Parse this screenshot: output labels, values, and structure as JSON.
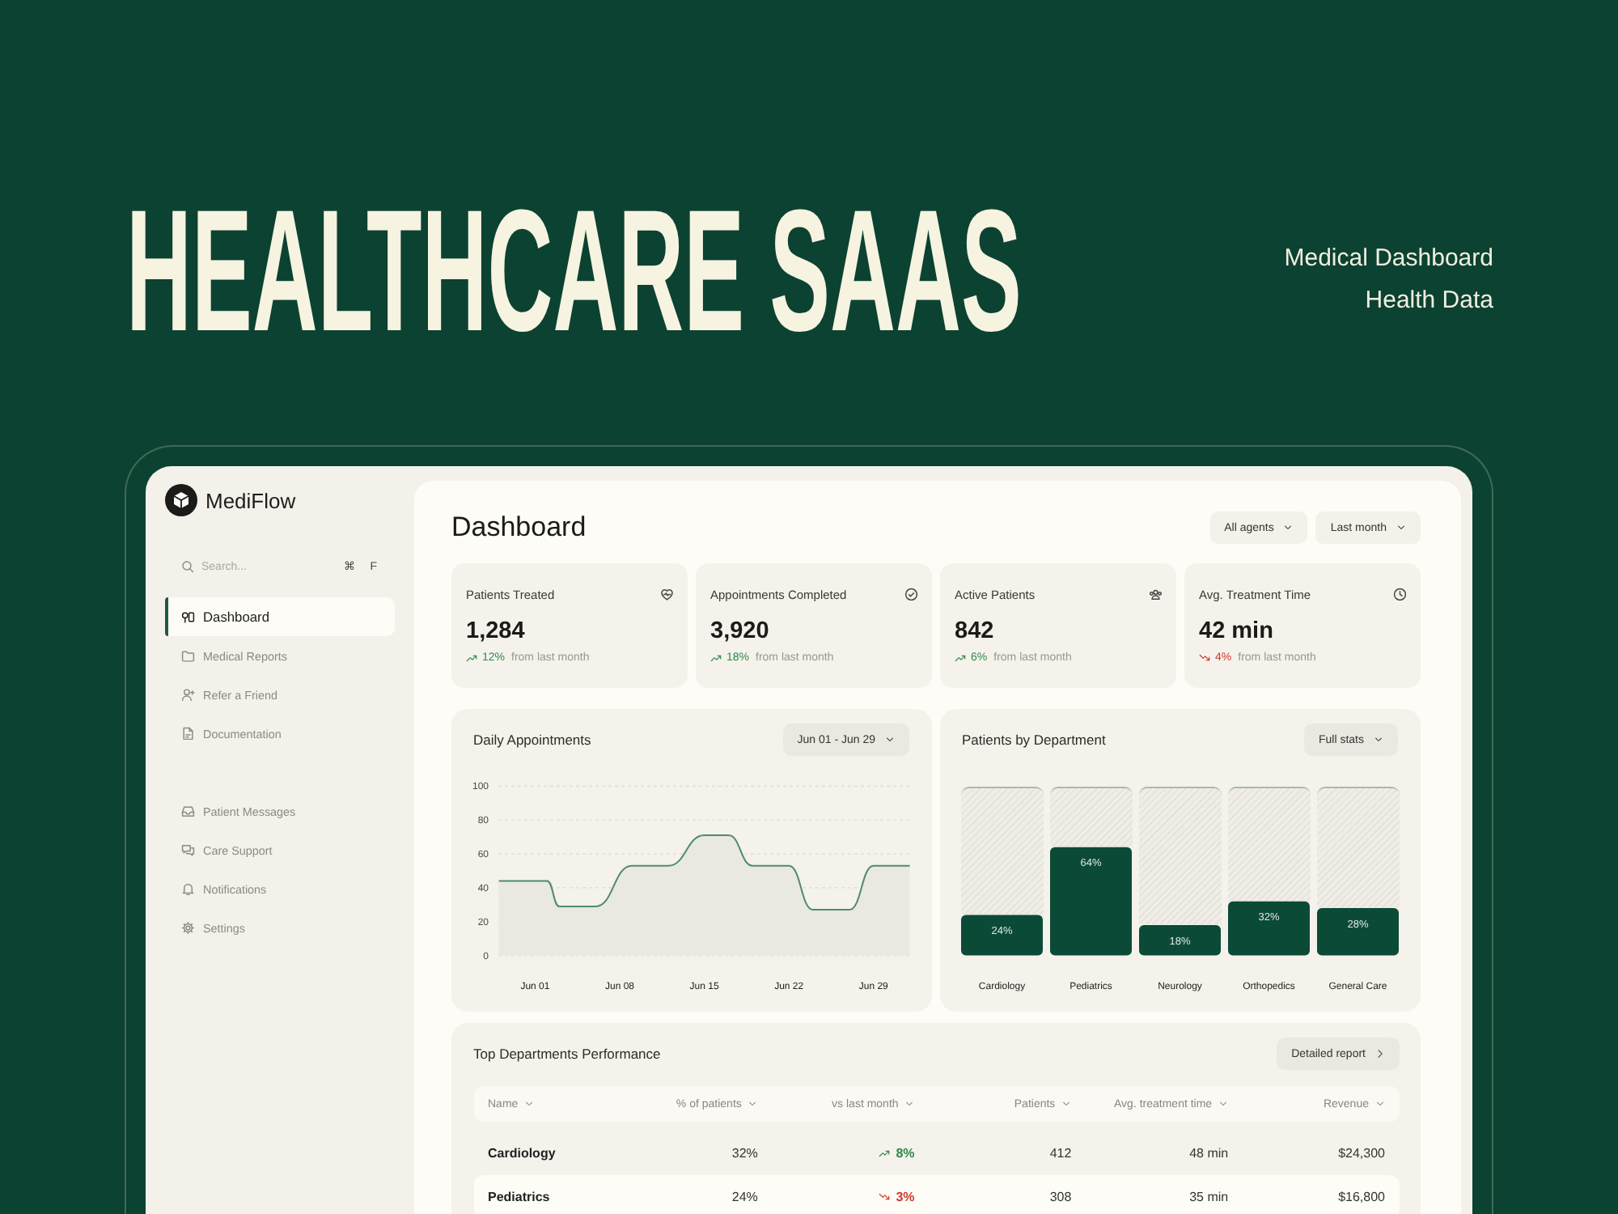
{
  "hero": {
    "title": "HEALTHCARE SAAS",
    "tags": [
      "Medical Dashboard",
      "Health Data"
    ]
  },
  "app": {
    "name": "MediFlow"
  },
  "sidebar": {
    "search": {
      "placeholder": "Search...",
      "shortcut": [
        "⌘",
        "F"
      ]
    },
    "groups": [
      {
        "items": [
          {
            "label": "Dashboard",
            "selected": true
          },
          {
            "label": "Medical Reports",
            "selected": false
          },
          {
            "label": "Refer a Friend",
            "selected": false
          },
          {
            "label": "Documentation",
            "selected": false
          }
        ]
      },
      {
        "items": [
          {
            "label": "Patient Messages",
            "selected": false
          },
          {
            "label": "Care Support",
            "selected": false
          },
          {
            "label": "Notifications",
            "selected": false
          },
          {
            "label": "Settings",
            "selected": false
          }
        ]
      }
    ]
  },
  "header": {
    "title": "Dashboard",
    "filters": [
      "All agents",
      "Last month"
    ]
  },
  "stats": [
    {
      "label": "Patients Treated",
      "value": "1,284",
      "change": {
        "kind": "up",
        "value": "12%"
      },
      "note": "from last month"
    },
    {
      "label": "Appointments Completed",
      "value": "3,920",
      "change": {
        "kind": "up",
        "value": "18%"
      },
      "note": "from last month"
    },
    {
      "label": "Active Patients",
      "value": "842",
      "change": {
        "kind": "up",
        "value": "6%"
      },
      "note": "from last month"
    },
    {
      "label": "Avg. Treatment Time",
      "value": "42 min",
      "change": {
        "kind": "down",
        "value": "4%"
      },
      "note": "from last month"
    }
  ],
  "daily_appointments": {
    "title": "Daily Appointments",
    "range": "Jun 01 - Jun 29",
    "chart_data": {
      "type": "area",
      "x": [
        "--05-29",
        "--06-02",
        "--06-03",
        "--06-06",
        "--06-09",
        "--06-12",
        "--06-15",
        "--06-17",
        "--06-19",
        "--06-22",
        "--06-24",
        "--06-27",
        "--06-29",
        "--07-02"
      ],
      "values": [
        44,
        44,
        29,
        29,
        53,
        53,
        71,
        71,
        53,
        53,
        27,
        27,
        53,
        53
      ],
      "xlim": [
        "--05-29",
        "--07-02"
      ],
      "ylim": [
        0,
        100
      ],
      "xticks": [
        {
          "value": "--06-01",
          "label": "Jun 01"
        },
        {
          "value": "--06-08",
          "label": "Jun 08"
        },
        {
          "value": "--06-15",
          "label": "Jun 15"
        },
        {
          "value": "--06-22",
          "label": "Jun 22"
        },
        {
          "value": "--06-29",
          "label": "Jun 29"
        }
      ],
      "yticks": [
        0,
        20,
        40,
        60,
        80,
        100
      ],
      "grid": true,
      "color": "#4f8a72"
    }
  },
  "patients_by_department": {
    "title": "Patients by Department",
    "button": "Full stats",
    "chart_data": {
      "type": "bar",
      "categories": [
        "Cardiology",
        "Pediatrics",
        "Neurology",
        "Orthopedics",
        "General Care"
      ],
      "values": [
        24,
        64,
        18,
        32,
        28
      ],
      "value_labels": [
        "24%",
        "64%",
        "18%",
        "32%",
        "28%"
      ],
      "ylim": [
        0,
        100
      ],
      "color": "#0c4a38"
    }
  },
  "top_departments": {
    "title": "Top Departments Performance",
    "button": "Detailed report",
    "columns": [
      "Name",
      "% of patients",
      "vs last month",
      "Patients",
      "Avg. treatment time",
      "Revenue"
    ],
    "rows": [
      {
        "name": "Cardiology",
        "percent": "32%",
        "change": {
          "kind": "up",
          "value": "8%"
        },
        "patients": "412",
        "avg_time": "48 min",
        "revenue": "$24,300",
        "selected": false
      },
      {
        "name": "Pediatrics",
        "percent": "24%",
        "change": {
          "kind": "down",
          "value": "3%"
        },
        "patients": "308",
        "avg_time": "35 min",
        "revenue": "$16,800",
        "selected": true
      }
    ]
  }
}
